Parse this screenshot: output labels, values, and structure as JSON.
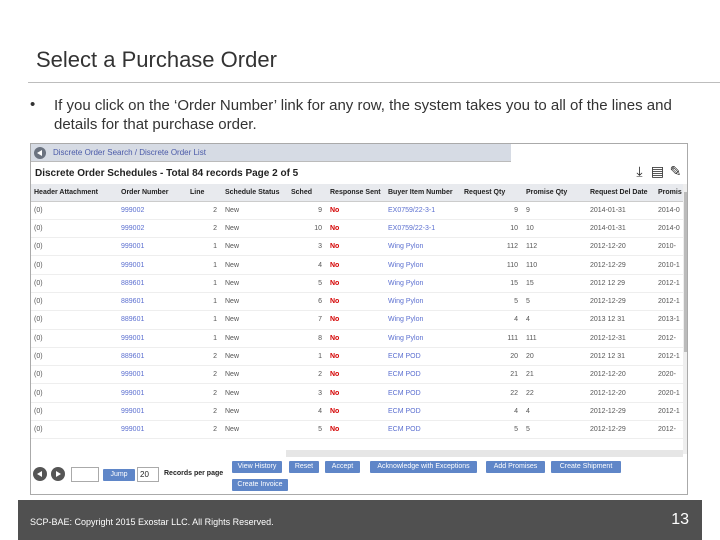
{
  "slide": {
    "title": "Select a Purchase Order",
    "bullet": "•",
    "bullet_text": "If you click on the ‘Order Number’ link for any row, the system takes you to all of the lines and details for that purchase order.",
    "footer_text": "SCP-BAE: Copyright 2015 Exostar LLC. All Rights Reserved.",
    "page_number": "13"
  },
  "screenshot": {
    "breadcrumb": "Discrete Order Search / Discrete Order List",
    "title": "Discrete Order Schedules - Total 84 records Page 2 of 5",
    "columns": [
      "Header Attachment",
      "Order Number",
      "Line",
      "Schedule Status",
      "Sched",
      "Response Sent",
      "Buyer Item Number",
      "Request Qty",
      "Promise Qty",
      "Request Del Date",
      "Promis"
    ],
    "rows": [
      {
        "attach": "(0)",
        "order": "999002",
        "line": "2",
        "status": "New",
        "sched": "9",
        "resp": "No",
        "item": "EX0759/22-3-1",
        "rqty": "9",
        "pqty": "9",
        "rdate": "2014-01-31",
        "pdate": "2014-0"
      },
      {
        "attach": "(0)",
        "order": "999002",
        "line": "2",
        "status": "New",
        "sched": "10",
        "resp": "No",
        "item": "EX0759/22-3-1",
        "rqty": "10",
        "pqty": "10",
        "rdate": "2014-01-31",
        "pdate": "2014-0"
      },
      {
        "attach": "(0)",
        "order": "999001",
        "line": "1",
        "status": "New",
        "sched": "3",
        "resp": "No",
        "item": "Wing Pylon",
        "rqty": "112",
        "pqty": "112",
        "rdate": "2012-12-20",
        "pdate": "2010-"
      },
      {
        "attach": "(0)",
        "order": "999001",
        "line": "1",
        "status": "New",
        "sched": "4",
        "resp": "No",
        "item": "Wing Pylon",
        "rqty": "110",
        "pqty": "110",
        "rdate": "2012-12-29",
        "pdate": "2010-1"
      },
      {
        "attach": "(0)",
        "order": "889601",
        "line": "1",
        "status": "New",
        "sched": "5",
        "resp": "No",
        "item": "Wing Pylon",
        "rqty": "15",
        "pqty": "15",
        "rdate": "2012 12 29",
        "pdate": "2012-1"
      },
      {
        "attach": "(0)",
        "order": "889601",
        "line": "1",
        "status": "New",
        "sched": "6",
        "resp": "No",
        "item": "Wing Pylon",
        "rqty": "5",
        "pqty": "5",
        "rdate": "2012-12-29",
        "pdate": "2012-1"
      },
      {
        "attach": "(0)",
        "order": "889601",
        "line": "1",
        "status": "New",
        "sched": "7",
        "resp": "No",
        "item": "Wing Pylon",
        "rqty": "4",
        "pqty": "4",
        "rdate": "2013 12 31",
        "pdate": "2013-1"
      },
      {
        "attach": "(0)",
        "order": "999001",
        "line": "1",
        "status": "New",
        "sched": "8",
        "resp": "No",
        "item": "Wing Pylon",
        "rqty": "111",
        "pqty": "111",
        "rdate": "2012-12-31",
        "pdate": "2012-"
      },
      {
        "attach": "(0)",
        "order": "889601",
        "line": "2",
        "status": "New",
        "sched": "1",
        "resp": "No",
        "item": "ECM POD",
        "rqty": "20",
        "pqty": "20",
        "rdate": "2012 12 31",
        "pdate": "2012-1"
      },
      {
        "attach": "(0)",
        "order": "999001",
        "line": "2",
        "status": "New",
        "sched": "2",
        "resp": "No",
        "item": "ECM POD",
        "rqty": "21",
        "pqty": "21",
        "rdate": "2012-12-20",
        "pdate": "2020-"
      },
      {
        "attach": "(0)",
        "order": "999001",
        "line": "2",
        "status": "New",
        "sched": "3",
        "resp": "No",
        "item": "ECM POD",
        "rqty": "22",
        "pqty": "22",
        "rdate": "2012-12-20",
        "pdate": "2020-1"
      },
      {
        "attach": "(0)",
        "order": "999001",
        "line": "2",
        "status": "New",
        "sched": "4",
        "resp": "No",
        "item": "ECM POD",
        "rqty": "4",
        "pqty": "4",
        "rdate": "2012-12-29",
        "pdate": "2012-1"
      },
      {
        "attach": "(0)",
        "order": "999001",
        "line": "2",
        "status": "New",
        "sched": "5",
        "resp": "No",
        "item": "ECM POD",
        "rqty": "5",
        "pqty": "5",
        "rdate": "2012-12-29",
        "pdate": "2012-"
      }
    ],
    "pager": {
      "page_size": "20",
      "page_size_label": "Records per page"
    },
    "buttons": {
      "jump": "Jump",
      "view_history": "View History",
      "reset": "Reset",
      "accept": "Accept",
      "ack_exceptions": "Acknowledge with Exceptions",
      "add_promises": "Add Promises",
      "create_shipment": "Create Shipment",
      "create_invoice": "Create Invoice"
    },
    "icons": [
      "download-icon",
      "export-document-icon",
      "edit-icon"
    ],
    "colors": {
      "highlight": "#d40000",
      "button": "#5f86c8",
      "link": "#5b6fd0",
      "footer": "#505050"
    }
  }
}
